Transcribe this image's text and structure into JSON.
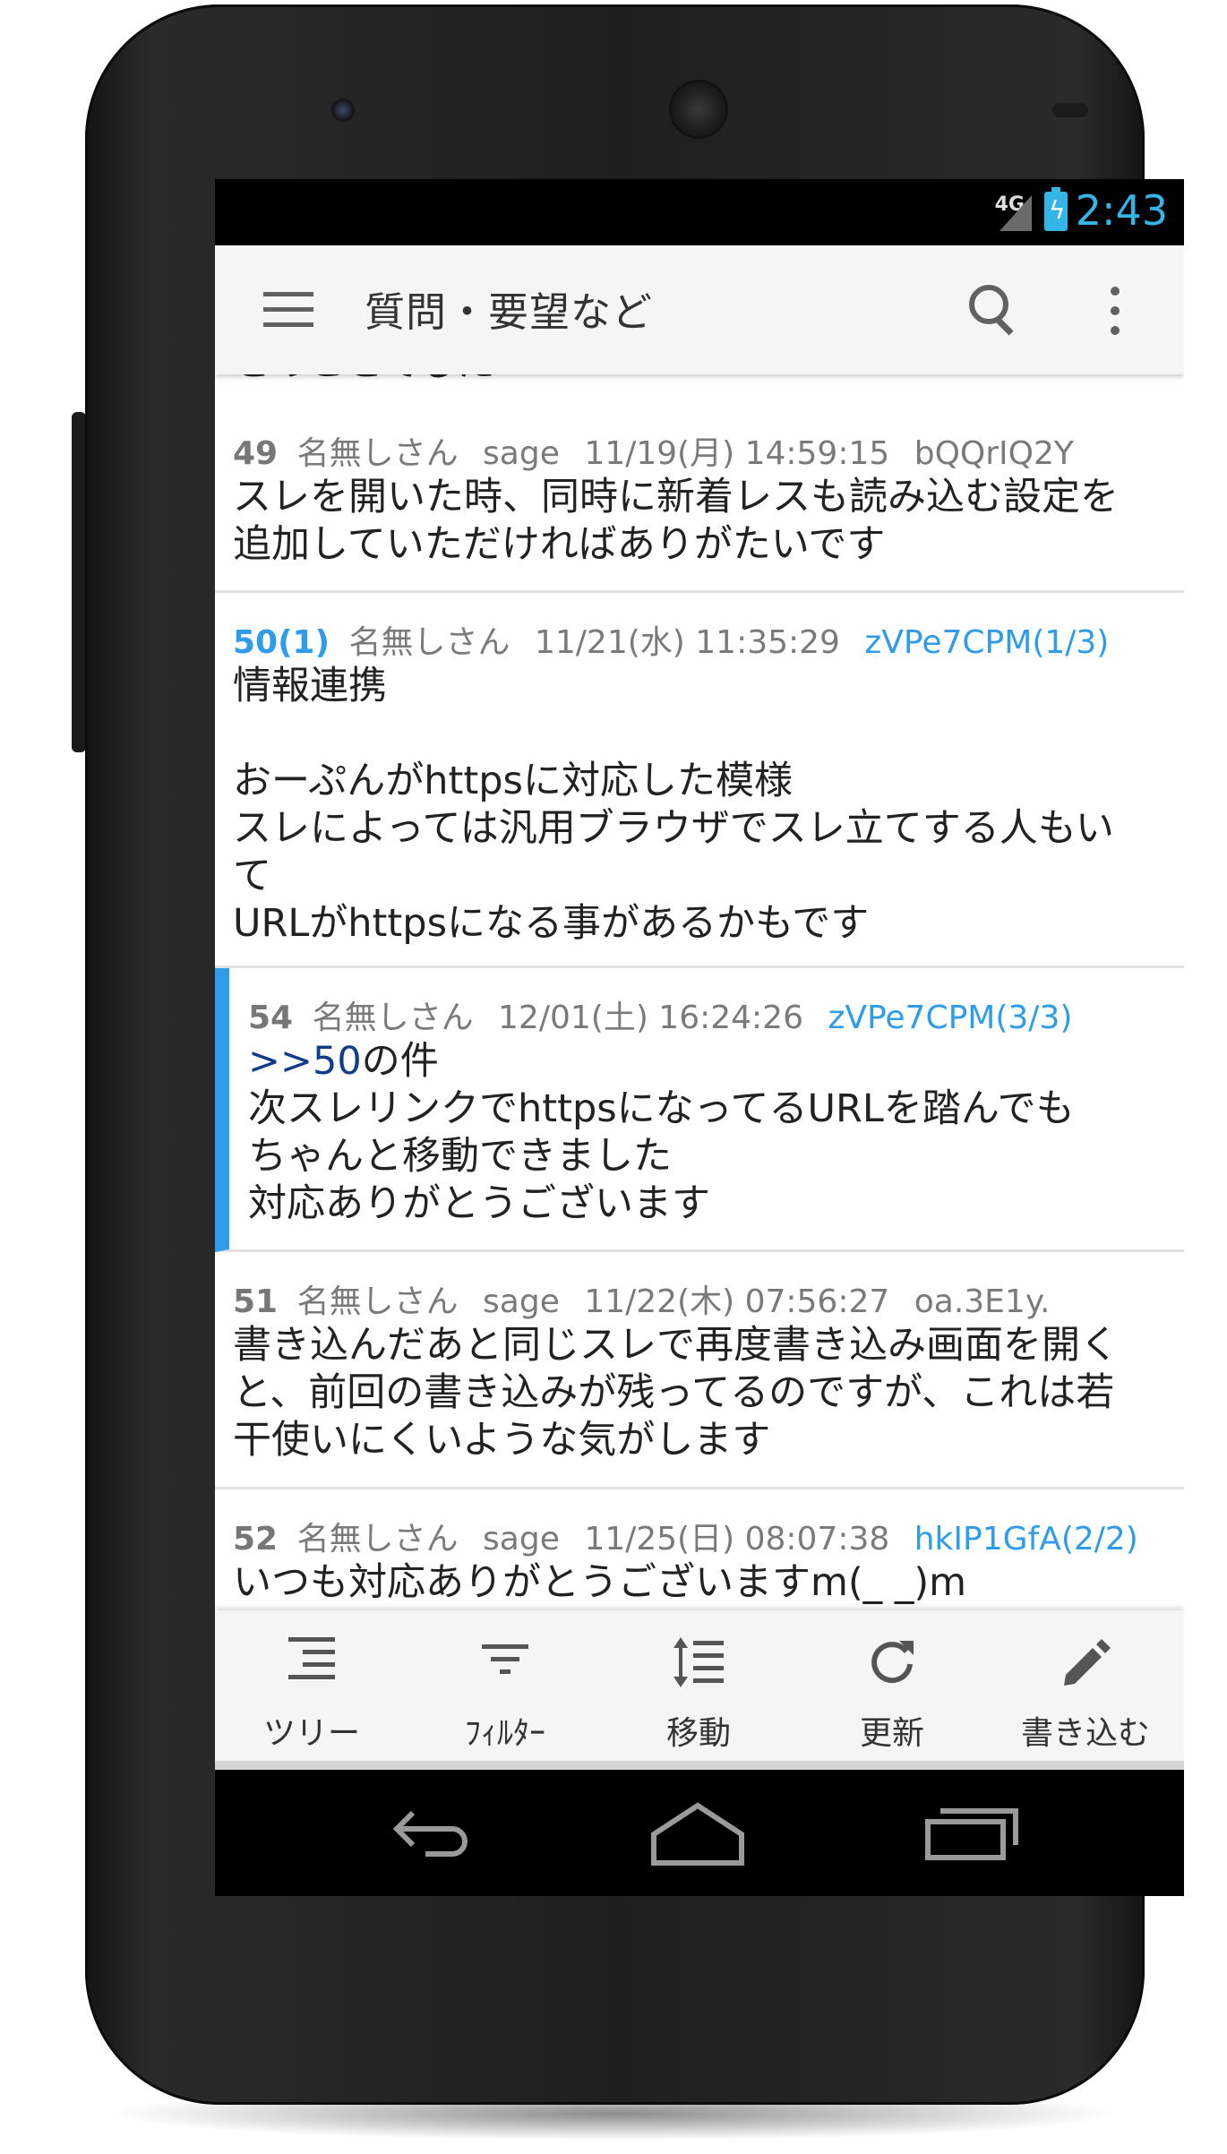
{
  "status_bar": {
    "network": "4G",
    "time": "2:43"
  },
  "app_bar": {
    "title": "質問・要望など"
  },
  "posts": [
    {
      "body": [
        "とのことでした"
      ]
    },
    {
      "num": "49",
      "name": "名無しさん",
      "mail": "sage",
      "date": "11/19(月) 14:59:15",
      "id": "bQQrIQ2Y",
      "body": [
        "スレを開いた時、同時に新着レスも読み込む設定を",
        "追加していただければありがたいです"
      ]
    },
    {
      "num": "50(1)",
      "name": "名無しさん",
      "date": "11/21(水) 11:35:29",
      "id": "zVPe7CPM(1/3)",
      "body": [
        "情報連携",
        "",
        "おーぷんがhttpsに対応した模様",
        "スレによっては汎用ブラウザでスレ立てする人もい",
        "て",
        "URLがhttpsになる事があるかもです"
      ]
    },
    {
      "num": "54",
      "name": "名無しさん",
      "date": "12/01(土) 16:24:26",
      "id": "zVPe7CPM(3/3)",
      "anchor": ">>50",
      "anchor_suffix": "の件",
      "body": [
        "次スレリンクでhttpsになってるURLを踏んでも",
        "ちゃんと移動できました",
        "対応ありがとうございます"
      ]
    },
    {
      "num": "51",
      "name": "名無しさん",
      "mail": "sage",
      "date": "11/22(木) 07:56:27",
      "id": "oa.3E1y.",
      "body": [
        "書き込んだあと同じスレで再度書き込み画面を開く",
        "と、前回の書き込みが残ってるのですが、これは若",
        "干使いにくいような気がします"
      ]
    },
    {
      "num": "52",
      "name": "名無しさん",
      "mail": "sage",
      "date": "11/25(日) 08:07:38",
      "id": "hkIP1GfA(2/2)",
      "body": [
        "いつも対応ありがとうございますm(_ _)m"
      ]
    }
  ],
  "bottom_bar": {
    "tree": "ツリー",
    "filter": "ﾌｨﾙﾀｰ",
    "move": "移動",
    "refresh": "更新",
    "write": "書き込む"
  },
  "colors": {
    "accent": "#2f9cea",
    "anchor": "#0f3d8c",
    "status_accent": "#33b5e5"
  }
}
